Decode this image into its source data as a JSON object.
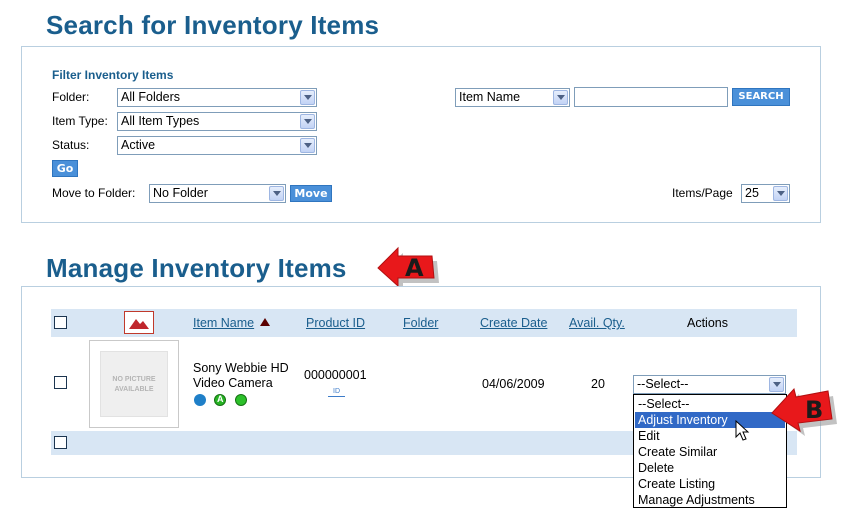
{
  "search_section": {
    "title": "Search for Inventory Items",
    "filter_title": "Filter Inventory Items",
    "folder_label": "Folder:",
    "folder_value": "All Folders",
    "item_type_label": "Item Type:",
    "item_type_value": "All Item Types",
    "status_label": "Status:",
    "status_value": "Active",
    "go_label": "Go",
    "move_folder_label": "Move to Folder:",
    "move_folder_value": "No Folder",
    "move_label": "Move",
    "search_field_value": "Item Name",
    "search_query": "",
    "search_button": "SEARCH",
    "items_per_page_label": "Items/Page",
    "items_per_page_value": "25"
  },
  "manage_section": {
    "title": "Manage Inventory Items",
    "columns": {
      "item_name": "Item Name",
      "product_id": "Product ID",
      "folder": "Folder",
      "create_date": "Create Date",
      "avail_qty": "Avail. Qty.",
      "actions": "Actions"
    },
    "row": {
      "no_picture": "NO PICTURE AVAILABLE",
      "item_name_line1": "Sony Webbie HD",
      "item_name_line2": "Video Camera",
      "product_id": "000000001",
      "id_badge": "ID",
      "folder": "",
      "create_date": "04/06/2009",
      "avail_qty": "20",
      "action_select": "--Select--"
    },
    "actions_dropdown": [
      "--Select--",
      "Adjust Inventory",
      "Edit",
      "Create Similar",
      "Delete",
      "Create Listing",
      "Manage Adjustments"
    ]
  },
  "callouts": {
    "a": "A",
    "b": "B"
  },
  "colors": {
    "heading": "#1a5e8d",
    "accent_button": "#4a90d9",
    "table_header": "#d8e6f4",
    "highlight": "#3169c6",
    "callout_red": "#e8181b"
  }
}
